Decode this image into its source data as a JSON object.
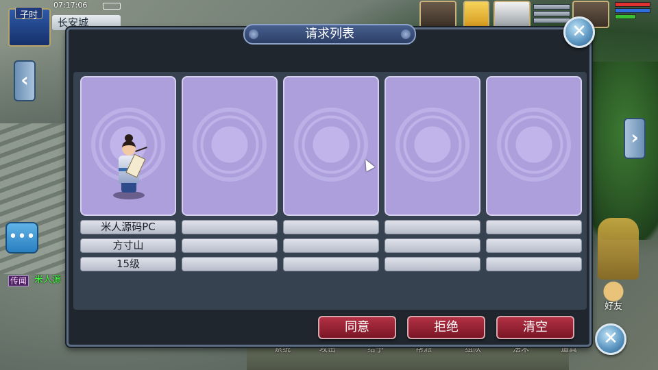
{
  "hud": {
    "time_period": "子时",
    "clock": "07:17:06",
    "location": "长安城",
    "rumor_tag": "传闻",
    "rumor_text": "米人源"
  },
  "bottom_menu": [
    "系统",
    "攻击",
    "给予",
    "帮派",
    "组队",
    "法术",
    "道具"
  ],
  "right_side": {
    "friends_label": "好友"
  },
  "dialog": {
    "title": "请求列表",
    "requests": [
      {
        "name": "米人源码PC",
        "school": "方寸山",
        "level": "15级",
        "has_character": true
      },
      {
        "name": "",
        "school": "",
        "level": "",
        "has_character": false
      },
      {
        "name": "",
        "school": "",
        "level": "",
        "has_character": false
      },
      {
        "name": "",
        "school": "",
        "level": "",
        "has_character": false
      },
      {
        "name": "",
        "school": "",
        "level": "",
        "has_character": false
      }
    ],
    "buttons": {
      "agree": "同意",
      "refuse": "拒绝",
      "clear": "清空"
    }
  },
  "icons": {
    "close": "close-icon",
    "chat": "chat-bubble-icon",
    "nav_left": "chevron-left-icon",
    "nav_right": "chevron-right-icon",
    "friends": "handshake-icon"
  },
  "colors": {
    "card_bg": "#ad9fdc",
    "button_red": "#9e2435",
    "title_bar": "#3a5080",
    "status_hp": "#e03030",
    "status_mp": "#2f6fe0",
    "status_sp": "#38c030"
  }
}
